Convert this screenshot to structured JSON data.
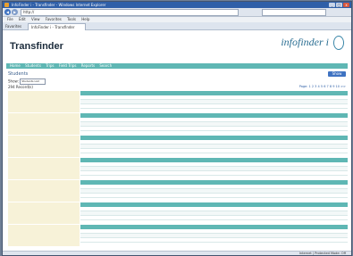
{
  "window": {
    "title": "InfoFinder i - Transfinder - Windows Internet Explorer",
    "minimize": "_",
    "maximize": "□",
    "close": "x"
  },
  "address_bar": {
    "url": "http://",
    "back": "◀",
    "forward": "▶"
  },
  "menu": [
    "File",
    "Edit",
    "View",
    "Favorites",
    "Tools",
    "Help"
  ],
  "browser_tab": {
    "favorites": "Favorites",
    "label": "InfoFinder i - Transfinder"
  },
  "page": {
    "brand": "Transfinder",
    "logo": "infofinder",
    "logo_suffix": "i",
    "nav": [
      "Home",
      "Students",
      "Trips",
      "Field Trips",
      "Reports",
      "Search"
    ],
    "section_title": "Students",
    "show_button": "Show Search",
    "filter_label": "Show:",
    "filter_value": "Students List",
    "count": "294 Record(s)",
    "pager": "Page: 1 2 3 4 5 6 7 8 9 10 >>"
  },
  "status_bar": {
    "right": "Internet | Protected Mode: Off"
  }
}
